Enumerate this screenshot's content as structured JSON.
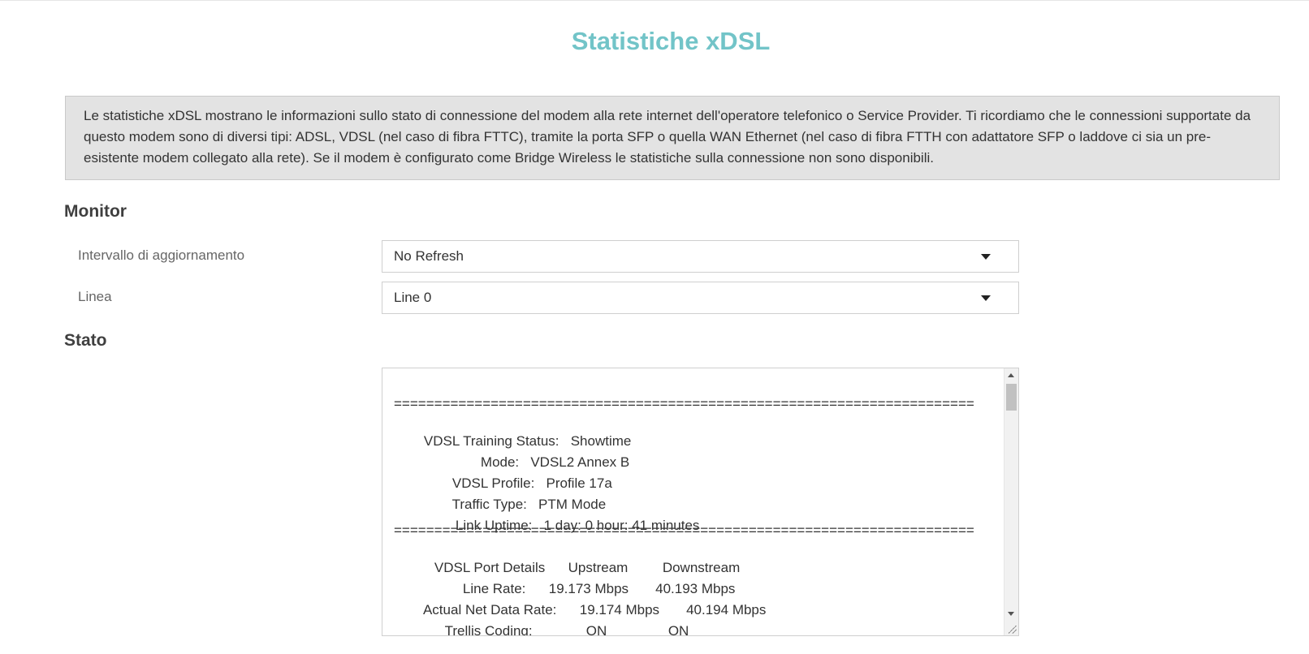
{
  "header": {
    "title": "Statistiche xDSL"
  },
  "info": {
    "text": "Le statistiche xDSL mostrano le informazioni sullo stato di connessione del modem alla rete internet dell'operatore telefonico o Service Provider. Ti ricordiamo che le connessioni supportate da questo modem sono di diversi tipi: ADSL, VDSL (nel caso di fibra FTTC), tramite la porta SFP o quella WAN Ethernet (nel caso di fibra FTTH con adattatore SFP o laddove ci sia un pre-esistente modem collegato alla rete). Se il modem è configurato come Bridge Wireless le statistiche sulla connessione non sono disponibili."
  },
  "monitor": {
    "title": "Monitor",
    "refresh_label": "Intervallo di aggiornamento",
    "refresh_value": "No Refresh",
    "line_label": "Linea",
    "line_value": "Line 0"
  },
  "stato": {
    "title": "Stato",
    "separator": "========================================================================",
    "lines": [
      {
        "label": "VDSL Training Status:",
        "value": "Showtime"
      },
      {
        "label": "Mode:",
        "value": "VDSL2 Annex B"
      },
      {
        "label": "VDSL Profile:",
        "value": "Profile 17a"
      },
      {
        "label": "Traffic Type:",
        "value": "PTM Mode"
      },
      {
        "label": "Link Uptime:",
        "value": "1 day: 0 hour: 41 minutes"
      }
    ],
    "port_header": {
      "label": "VDSL Port Details",
      "up": "Upstream",
      "down": "Downstream"
    },
    "port_rows": [
      {
        "label": "Line Rate:",
        "up": "19.173 Mbps",
        "down": "40.193 Mbps"
      },
      {
        "label": "Actual Net Data Rate:",
        "up": "19.174 Mbps",
        "down": "40.194 Mbps"
      },
      {
        "label": "Trellis Coding:",
        "up": "ON",
        "down": "ON"
      }
    ]
  },
  "icons": {
    "dropdown": "chevron-down-icon",
    "scroll_up": "arrow-up-icon",
    "scroll_down": "arrow-down-icon",
    "resize": "resize-grip-icon"
  },
  "colors": {
    "title": "#72c4c8",
    "info_bg": "#e3e3e3"
  }
}
